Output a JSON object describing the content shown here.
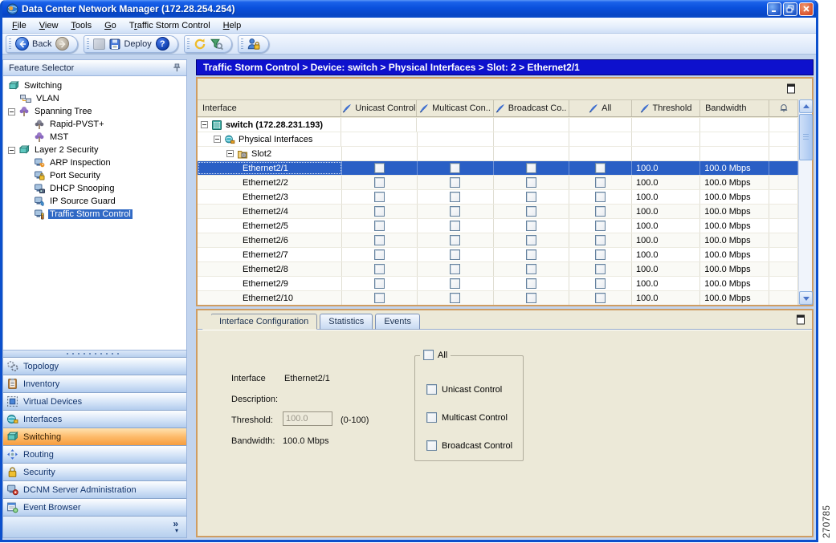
{
  "window": {
    "title": "Data Center Network Manager (172.28.254.254)"
  },
  "menubar": {
    "items": [
      {
        "label": "File",
        "u": 0
      },
      {
        "label": "View",
        "u": 0
      },
      {
        "label": "Tools",
        "u": 0
      },
      {
        "label": "Go",
        "u": 0
      },
      {
        "label": "Traffic Storm Control",
        "u": 1
      },
      {
        "label": "Help",
        "u": 0
      }
    ]
  },
  "toolbar": {
    "back_label": "Back",
    "deploy_label": "Deploy",
    "help_glyph": "?"
  },
  "feature_selector": {
    "title": "Feature Selector",
    "tree": [
      {
        "label": "Switching",
        "icon": "switching-device-icon",
        "depth": 0,
        "expander": null,
        "selected": false
      },
      {
        "label": "VLAN",
        "icon": "vlan-icon",
        "depth": 1,
        "expander": null,
        "selected": false
      },
      {
        "label": "Spanning Tree",
        "icon": "spanning-tree-icon",
        "depth": 1,
        "expander": "minus",
        "selected": false
      },
      {
        "label": "Rapid-PVST+",
        "icon": "rapid-pvst-icon",
        "depth": 2,
        "expander": null,
        "selected": false
      },
      {
        "label": "MST",
        "icon": "mst-icon",
        "depth": 2,
        "expander": null,
        "selected": false
      },
      {
        "label": "Layer 2 Security",
        "icon": "layer2-security-icon",
        "depth": 1,
        "expander": "minus",
        "selected": false
      },
      {
        "label": "ARP Inspection",
        "icon": "arp-inspection-icon",
        "depth": 2,
        "expander": null,
        "selected": false
      },
      {
        "label": "Port Security",
        "icon": "port-security-icon",
        "depth": 2,
        "expander": null,
        "selected": false
      },
      {
        "label": "DHCP Snooping",
        "icon": "dhcp-snooping-icon",
        "depth": 2,
        "expander": null,
        "selected": false
      },
      {
        "label": "IP Source Guard",
        "icon": "ip-source-guard-icon",
        "depth": 2,
        "expander": null,
        "selected": false
      },
      {
        "label": "Traffic Storm Control",
        "icon": "traffic-storm-icon",
        "depth": 2,
        "expander": null,
        "selected": true
      }
    ]
  },
  "nav": {
    "overflow_glyph": "»",
    "items": [
      {
        "label": "Topology",
        "icon": "topology-icon",
        "selected": false
      },
      {
        "label": "Inventory",
        "icon": "inventory-icon",
        "selected": false
      },
      {
        "label": "Virtual Devices",
        "icon": "virtual-devices-icon",
        "selected": false
      },
      {
        "label": "Interfaces",
        "icon": "interfaces-icon",
        "selected": false
      },
      {
        "label": "Switching",
        "icon": "switching-nav-icon",
        "selected": true
      },
      {
        "label": "Routing",
        "icon": "routing-icon",
        "selected": false
      },
      {
        "label": "Security",
        "icon": "security-icon",
        "selected": false
      },
      {
        "label": "DCNM Server Administration",
        "icon": "dcnm-admin-icon",
        "selected": false
      },
      {
        "label": "Event Browser",
        "icon": "event-browser-icon",
        "selected": false
      }
    ]
  },
  "breadcrumb": "Traffic Storm Control > Device: switch > Physical Interfaces > Slot: 2 > Ethernet2/1",
  "table": {
    "columns": [
      {
        "label": "Interface",
        "editable": false
      },
      {
        "label": "Unicast Control",
        "editable": true
      },
      {
        "label": "Multicast Con..",
        "editable": true
      },
      {
        "label": "Broadcast Co..",
        "editable": true
      },
      {
        "label": "All",
        "editable": true
      },
      {
        "label": "Threshold",
        "editable": true
      },
      {
        "label": "Bandwidth",
        "editable": false
      },
      {
        "label": "",
        "editable": false,
        "icon": "bell-icon"
      }
    ],
    "tree_rows": [
      {
        "kind": "device",
        "label": "switch (172.28.231.193)",
        "icon": "switch-chassis-icon"
      },
      {
        "kind": "group",
        "label": "Physical Interfaces",
        "icon": "physical-interfaces-icon"
      },
      {
        "kind": "group",
        "label": "Slot2",
        "icon": "slot-icon"
      }
    ],
    "interface_rows": [
      {
        "label": "Ethernet2/1",
        "unicast": false,
        "multicast": false,
        "broadcast": false,
        "all": false,
        "threshold": "100.0",
        "bandwidth": "100.0 Mbps",
        "selected": true
      },
      {
        "label": "Ethernet2/2",
        "unicast": false,
        "multicast": false,
        "broadcast": false,
        "all": false,
        "threshold": "100.0",
        "bandwidth": "100.0 Mbps",
        "selected": false
      },
      {
        "label": "Ethernet2/3",
        "unicast": false,
        "multicast": false,
        "broadcast": false,
        "all": false,
        "threshold": "100.0",
        "bandwidth": "100.0 Mbps",
        "selected": false
      },
      {
        "label": "Ethernet2/4",
        "unicast": false,
        "multicast": false,
        "broadcast": false,
        "all": false,
        "threshold": "100.0",
        "bandwidth": "100.0 Mbps",
        "selected": false
      },
      {
        "label": "Ethernet2/5",
        "unicast": false,
        "multicast": false,
        "broadcast": false,
        "all": false,
        "threshold": "100.0",
        "bandwidth": "100.0 Mbps",
        "selected": false
      },
      {
        "label": "Ethernet2/6",
        "unicast": false,
        "multicast": false,
        "broadcast": false,
        "all": false,
        "threshold": "100.0",
        "bandwidth": "100.0 Mbps",
        "selected": false
      },
      {
        "label": "Ethernet2/7",
        "unicast": false,
        "multicast": false,
        "broadcast": false,
        "all": false,
        "threshold": "100.0",
        "bandwidth": "100.0 Mbps",
        "selected": false
      },
      {
        "label": "Ethernet2/8",
        "unicast": false,
        "multicast": false,
        "broadcast": false,
        "all": false,
        "threshold": "100.0",
        "bandwidth": "100.0 Mbps",
        "selected": false
      },
      {
        "label": "Ethernet2/9",
        "unicast": false,
        "multicast": false,
        "broadcast": false,
        "all": false,
        "threshold": "100.0",
        "bandwidth": "100.0 Mbps",
        "selected": false
      },
      {
        "label": "Ethernet2/10",
        "unicast": false,
        "multicast": false,
        "broadcast": false,
        "all": false,
        "threshold": "100.0",
        "bandwidth": "100.0 Mbps",
        "selected": false
      }
    ]
  },
  "detail": {
    "tabs": [
      {
        "label": "Interface Configuration",
        "active": true
      },
      {
        "label": "Statistics",
        "active": false
      },
      {
        "label": "Events",
        "active": false
      }
    ],
    "fields": {
      "interface_label": "Interface",
      "interface_value": "Ethernet2/1",
      "description_label": "Description:",
      "threshold_label": "Threshold:",
      "threshold_value": "100.0",
      "threshold_hint": "(0-100)",
      "bandwidth_label": "Bandwidth:",
      "bandwidth_value": "100.0 Mbps"
    },
    "controls": {
      "all_label": "All",
      "all_checked": false,
      "items": [
        {
          "label": "Unicast Control",
          "checked": false
        },
        {
          "label": "Multicast Control",
          "checked": false
        },
        {
          "label": "Broadcast Control",
          "checked": false
        }
      ]
    }
  },
  "figure_number": "270785",
  "colors": {
    "selection": "#2a5fc5",
    "nav_selected": "#f79d3e",
    "breadcrumb_bg": "#0e11cd",
    "panel_border": "#cf9d62",
    "content_bg": "#ece9d8"
  }
}
